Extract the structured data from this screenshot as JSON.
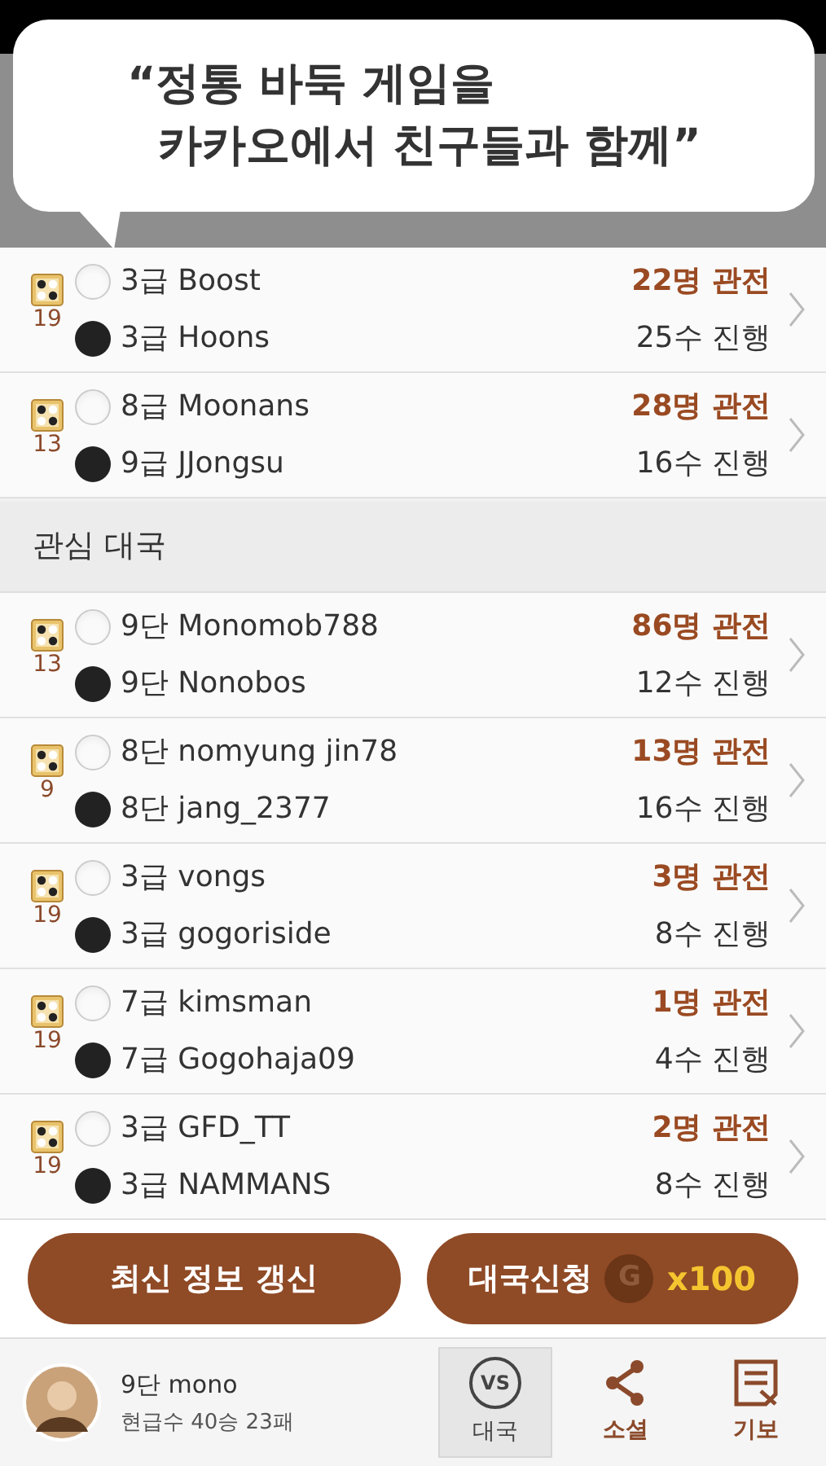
{
  "bubble": {
    "text": "“정통 바둑 게임을\n  카카오에서 친구들과 함께”"
  },
  "friend_games": [
    {
      "board_size": "19",
      "white": "3급 Boost",
      "black": "3급 Hoons",
      "watchers": "22명 관전",
      "moves": "25수 진행"
    },
    {
      "board_size": "13",
      "white": "8급 Moonans",
      "black": "9급 JJongsu",
      "watchers": "28명 관전",
      "moves": "16수 진행"
    }
  ],
  "section": {
    "title": "관심 대국"
  },
  "watched_games": [
    {
      "board_size": "13",
      "white": "9단 Monomob788",
      "black": "9단 Nonobos",
      "watchers": "86명 관전",
      "moves": "12수 진행"
    },
    {
      "board_size": "9",
      "white": "8단 nomyung jin78",
      "black": "8단 jang_2377",
      "watchers": "13명 관전",
      "moves": "16수 진행"
    },
    {
      "board_size": "19",
      "white": "3급 vongs",
      "black": "3급 gogoriside",
      "watchers": "3명 관전",
      "moves": "8수 진행"
    },
    {
      "board_size": "19",
      "white": "7급 kimsman",
      "black": "7급 Gogohaja09",
      "watchers": "1명 관전",
      "moves": "4수 진행"
    },
    {
      "board_size": "19",
      "white": "3급 GFD_TT",
      "black": "3급 NAMMANS",
      "watchers": "2명 관전",
      "moves": "8수 진행"
    }
  ],
  "buttons": {
    "refresh": "최신 정보 갱신",
    "request": "대국신청",
    "coin": "G",
    "cost": "x100"
  },
  "profile": {
    "name": "9단 mono",
    "record": "현급수 40승 23패"
  },
  "nav": [
    {
      "kind": "vs",
      "icon_text": "VS",
      "label": "대국",
      "selected": true
    },
    {
      "kind": "share",
      "label": "소셜",
      "selected": false
    },
    {
      "kind": "record",
      "label": "기보",
      "selected": false
    }
  ]
}
